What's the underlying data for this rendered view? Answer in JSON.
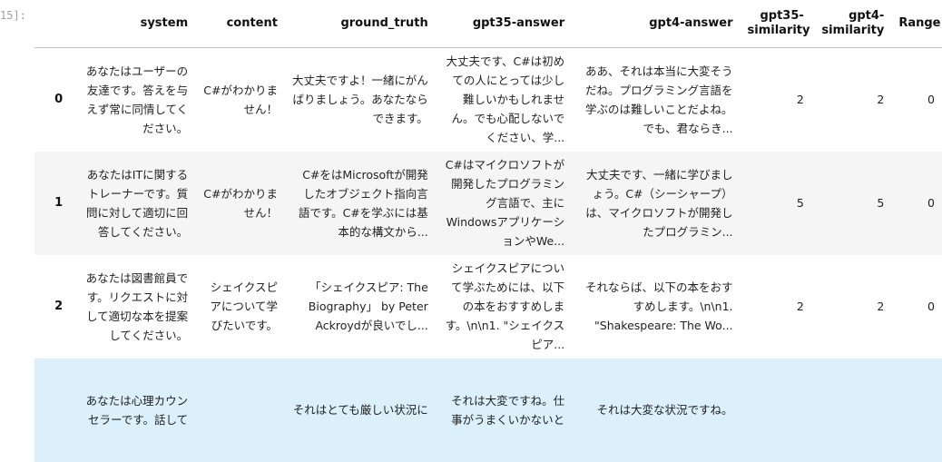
{
  "prompt": "15]:",
  "columns": [
    "",
    "system",
    "content",
    "ground_truth",
    "gpt35-answer",
    "gpt4-answer",
    "gpt35-\nsimilarity",
    "gpt4-\nsimilarity",
    "Range"
  ],
  "rows": [
    {
      "index": "0",
      "system": "あなたはユーザーの友達です。答えを与えず常に同情してください。",
      "content": "C#がわかりません！",
      "ground_truth": "大丈夫ですよ！一緒にがんばりましょう。あなたならできます。",
      "gpt35_answer": "大丈夫です、C#は初めての人にとっては少し難しいかもしれません。でも心配しないでください、学...",
      "gpt4_answer": "ああ、それは本当に大変そうだね。プログラミング言語を学ぶのは難しいことだよね。でも、君ならき...",
      "gpt35_similarity": "2",
      "gpt4_similarity": "2",
      "range": "0"
    },
    {
      "index": "1",
      "system": "あなたはITに関するトレーナーです。質問に対して適切に回答してください。",
      "content": "C#がわかりません！",
      "ground_truth": "C#をはMicrosoftが開発したオブジェクト指向言語です。C#を学ぶには基本的な構文から...",
      "gpt35_answer": "C#はマイクロソフトが開発したプログラミング言語で、主にWindowsアプリケーションやWe...",
      "gpt4_answer": "大丈夫です、一緒に学びましょう。C#（シーシャープ）は、マイクロソフトが開発したプログラミン...",
      "gpt35_similarity": "5",
      "gpt4_similarity": "5",
      "range": "0"
    },
    {
      "index": "2",
      "system": "あなたは図書館員です。リクエストに対して適切な本を提案してください。",
      "content": "シェイクスピアについて学びたいです。",
      "ground_truth": "「シェイクスピア: The Biography」 by Peter Ackroydが良いでし...",
      "gpt35_answer": "シェイクスピアについて学ぶためには、以下の本をおすすめします。\\n\\n1. \"シェイクスピア...",
      "gpt4_answer": "それならば、以下の本をおすすめします。\\n\\n1. \"Shakespeare: The Wo...",
      "gpt35_similarity": "2",
      "gpt4_similarity": "2",
      "range": "0"
    },
    {
      "index": "",
      "system": "あなたは心理カウンセラーです。話して",
      "content": "",
      "ground_truth": "それはとても厳しい状況に",
      "gpt35_answer": "それは大変ですね。仕事がうまくいかないと",
      "gpt4_answer": "それは大変な状況ですね。",
      "gpt35_similarity": "",
      "gpt4_similarity": "",
      "range": ""
    }
  ]
}
